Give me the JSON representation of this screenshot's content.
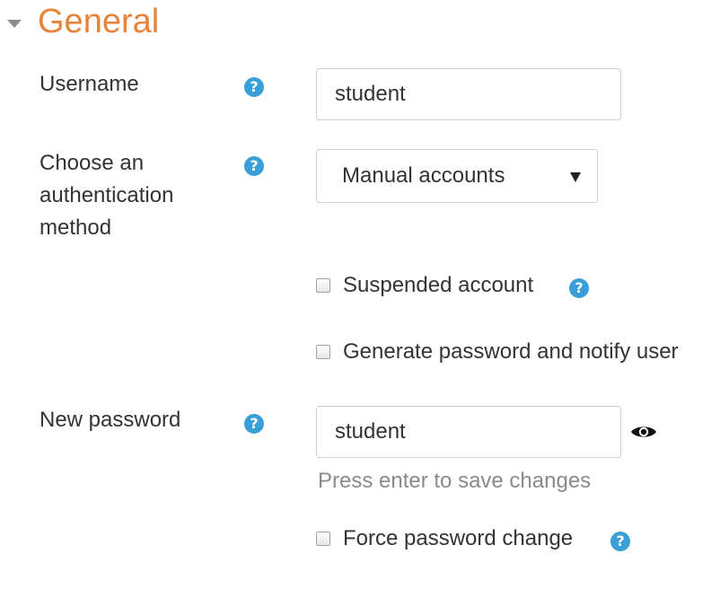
{
  "section": {
    "title": "General"
  },
  "fields": {
    "username": {
      "label": "Username",
      "value": "student",
      "help_icon": "question-circle-icon"
    },
    "auth": {
      "label": "Choose an authentication method",
      "selected": "Manual accounts",
      "help_icon": "question-circle-icon"
    },
    "suspended": {
      "label": "Suspended account",
      "checked": false,
      "help_icon": "question-circle-icon"
    },
    "generate_password": {
      "label": "Generate password and notify user",
      "checked": false
    },
    "new_password": {
      "label": "New password",
      "value": "student",
      "hint": "Press enter to save changes",
      "reveal_icon": "eye-icon",
      "help_icon": "question-circle-icon"
    },
    "force_change": {
      "label": "Force password change",
      "checked": false,
      "help_icon": "question-circle-icon"
    }
  },
  "colors": {
    "section_title": "#e8833a",
    "help_icon": "#3a9fd8",
    "hint_text": "#8a8a8a",
    "body_text": "#333333"
  }
}
